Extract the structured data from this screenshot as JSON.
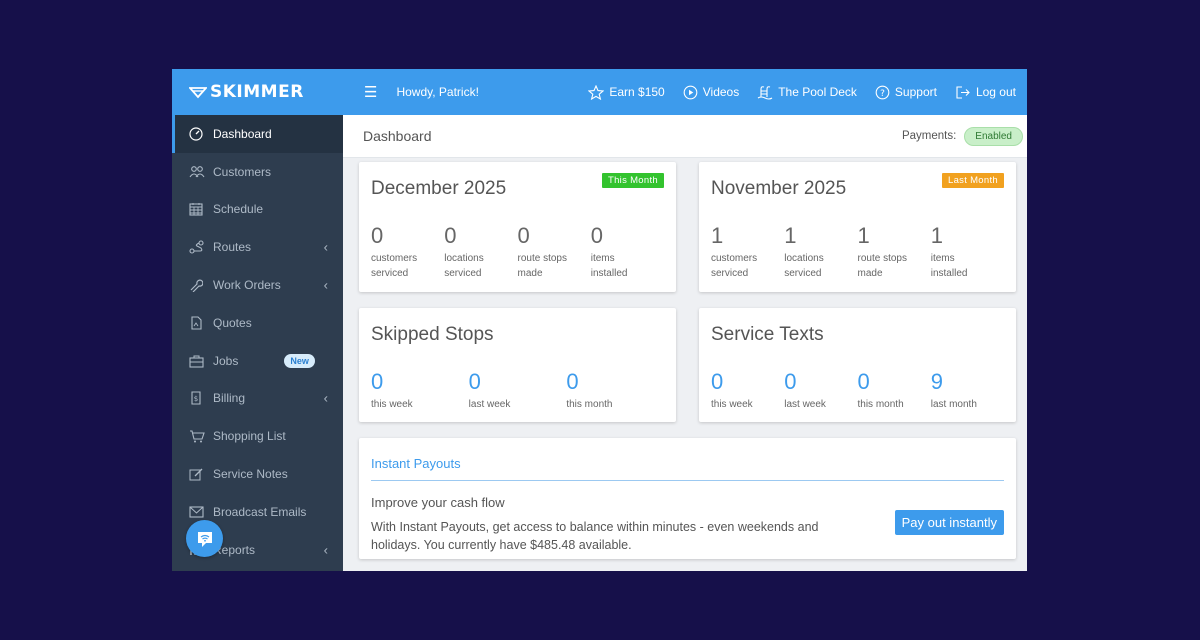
{
  "brand": {
    "name": "SKIMMER"
  },
  "sidebar": {
    "items": [
      {
        "label": "Dashboard",
        "icon": "dashboard-gauge-icon",
        "active": true
      },
      {
        "label": "Customers",
        "icon": "customers-icon"
      },
      {
        "label": "Schedule",
        "icon": "calendar-icon"
      },
      {
        "label": "Routes",
        "icon": "route-icon",
        "has_children": true
      },
      {
        "label": "Work Orders",
        "icon": "wrench-icon",
        "has_children": true
      },
      {
        "label": "Quotes",
        "icon": "document-icon"
      },
      {
        "label": "Jobs",
        "icon": "briefcase-icon",
        "badge": "New"
      },
      {
        "label": "Billing",
        "icon": "invoice-icon",
        "has_children": true
      },
      {
        "label": "Shopping List",
        "icon": "cart-icon"
      },
      {
        "label": "Service Notes",
        "icon": "pencil-icon"
      },
      {
        "label": "Broadcast Emails",
        "icon": "envelope-icon"
      },
      {
        "label": "Reports",
        "icon": "chart-icon",
        "has_children": true
      }
    ]
  },
  "topbar": {
    "greeting": "Howdy, Patrick!",
    "links": [
      {
        "label": "Earn $150",
        "icon": "star-icon"
      },
      {
        "label": "Videos",
        "icon": "play-icon"
      },
      {
        "label": "The Pool Deck",
        "icon": "pool-ladder-icon"
      },
      {
        "label": "Support",
        "icon": "help-circle-icon"
      },
      {
        "label": "Log out",
        "icon": "logout-icon"
      }
    ]
  },
  "header": {
    "title": "Dashboard",
    "payments_label": "Payments:",
    "payments_status": "Enabled"
  },
  "cards": {
    "this_month": {
      "title": "December 2025",
      "tag": "This Month",
      "stats": [
        {
          "value": "0",
          "label": "customers\nserviced"
        },
        {
          "value": "0",
          "label": "locations\nserviced"
        },
        {
          "value": "0",
          "label": "route stops\nmade"
        },
        {
          "value": "0",
          "label": "items\ninstalled"
        }
      ]
    },
    "last_month": {
      "title": "November 2025",
      "tag": "Last Month",
      "stats": [
        {
          "value": "1",
          "label": "customers\nserviced"
        },
        {
          "value": "1",
          "label": "locations\nserviced"
        },
        {
          "value": "1",
          "label": "route stops\nmade"
        },
        {
          "value": "1",
          "label": "items\ninstalled"
        }
      ]
    },
    "skipped": {
      "title": "Skipped Stops",
      "stats": [
        {
          "value": "0",
          "label": "this week"
        },
        {
          "value": "0",
          "label": "last week"
        },
        {
          "value": "0",
          "label": "this month"
        }
      ]
    },
    "texts": {
      "title": "Service Texts",
      "stats": [
        {
          "value": "0",
          "label": "this week"
        },
        {
          "value": "0",
          "label": "last week"
        },
        {
          "value": "0",
          "label": "this month"
        },
        {
          "value": "9",
          "label": "last month"
        }
      ]
    },
    "payouts": {
      "title": "Instant Payouts",
      "subtitle": "Improve your cash flow",
      "body": "With Instant Payouts, get access to balance within minutes - even weekends and holidays. You currently have $485.48 available.",
      "button": "Pay out instantly"
    }
  },
  "colors": {
    "primary": "#3d9bec",
    "sidebar": "#2e3d4f",
    "background": "#16104a",
    "tag_green": "#33c32e",
    "tag_orange": "#f1a11f"
  }
}
